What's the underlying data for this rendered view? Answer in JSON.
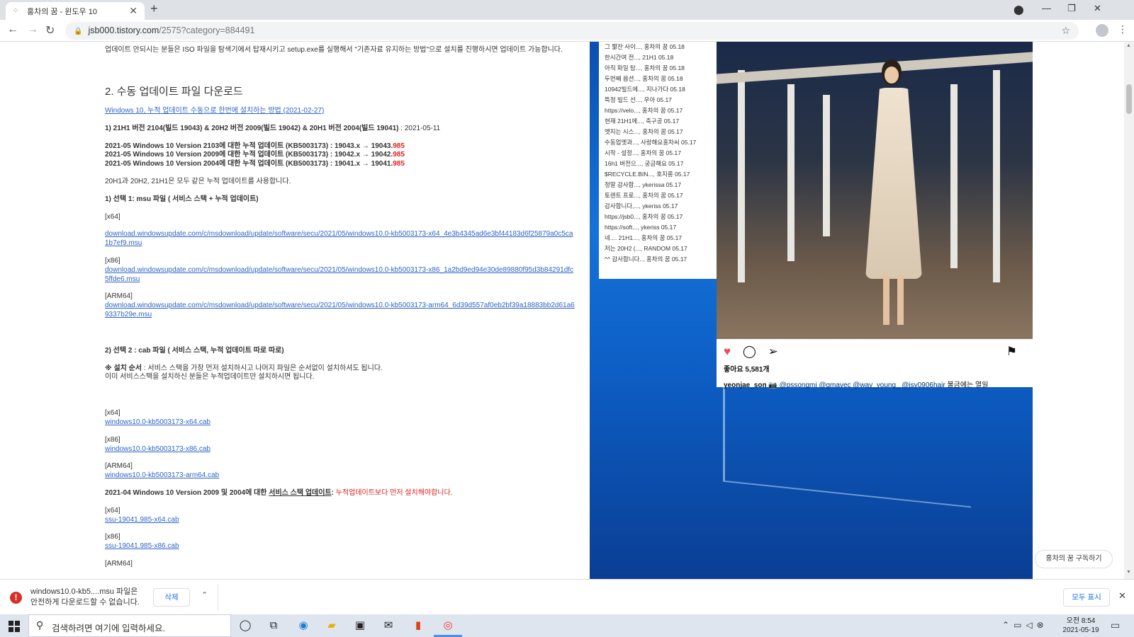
{
  "browser": {
    "tab_title": "홍차의 꿈 - 윈도우 10",
    "url_host": "jsb000.tistory.com",
    "url_path": "/2575?category=884491"
  },
  "article": {
    "intro": "업데이트 안되시는 분들은 ISO 파일을 탐색기에서 탑재시키고 setup.exe를 실행해서 \"기존자료 유지하는 방법\"으로 설치를 진행하시면 업데이트 가능합니다.",
    "heading": "2. 수동 업데이트 파일 다운로드",
    "guide_link": "Windows 10, 누적 업데이트 수동으로 한번에 설치하는 방법 (2021-02-27)",
    "versions_line": "1) 21H1 버전 2104(빌드 19043) & 20H2 버전 2009(빌드 19042) & 20H1 버전 2004(빌드 19041)",
    "versions_date": " : 2021-05-11",
    "kb_lines": [
      {
        "text": "2021-05 Windows 10 Version 2103에 대한 누적 업데이트 (KB5003173) : 19043.x → 19043.",
        "red": "985"
      },
      {
        "text": "2021-05 Windows 10 Version 2009에 대한 누적 업데이트 (KB5003173) : 19042.x → 19042.",
        "red": "985"
      },
      {
        "text": "2021-05 Windows 10 Version 2004에 대한 누적 업데이트 (KB5003173) : 19041.x → 19041.",
        "red": "985"
      }
    ],
    "same_update": "20H1과 20H2, 21H1은 모두 같은 누적 업데이트를 사용합니다.",
    "option1": "1) 선택 1: msu 파일 ( 서비스 스택 + 누적 업데이트)",
    "x64_label": "[x64]",
    "x86_label": "[x86]",
    "arm64_label": "[ARM64]",
    "msu_x64": "download.windowsupdate.com/c/msdownload/update/software/secu/2021/05/windows10.0-kb5003173-x64_4e3b4345ad6e3bf44183d6f25879a0c5ca1b7ef9.msu",
    "msu_x86": "download.windowsupdate.com/c/msdownload/update/software/secu/2021/05/windows10.0-kb5003173-x86_1a2bd9ed94e30de89880f95d3b84291dfc5ffde6.msu",
    "msu_arm64": "download.windowsupdate.com/c/msdownload/update/software/secu/2021/05/windows10.0-kb5003173-arm64_6d39d557af0eb2bf39a18883bb2d61a69337b29e.msu",
    "option2": "2) 선택 2 : cab 파일 ( 서비스 스택, 누적 업데이트 따로 따로)",
    "install_order_label": "※ 설치 순서",
    "install_order_text": " : 서비스 스택을 가장 먼저 설치하시고 나머지 파일은 순서없이 설치하셔도 됩니다.",
    "install_note": "이미 서비스스택을 설치하신 분들은 누적업데이트만 설치하시면 됩니다.",
    "cab_x64": "windows10.0-kb5003173-x64.cab",
    "cab_x86": "windows10.0-kb5003173-x86.cab",
    "cab_arm64": "windows10.0-kb5003173-arm64.cab",
    "ssu_line_pre": "2021-04 Windows 10 Version 2009 및 2004에 대한 ",
    "ssu_line_link": "서비스 스택 업데이트",
    "ssu_line_colon": ": ",
    "ssu_line_red": "누적업데이트보다 먼저 설치해야합니다.",
    "ssu_x64": "ssu-19041.985-x64.cab",
    "ssu_x86": "ssu-19041.985-x86.cab",
    "truncated_label": "[ARM64]"
  },
  "comments": [
    "그 짧잔 사이..., 홍차의 꿈 05.18",
    "한시간여 전..., 21H1 05.18",
    "아직 파일 탐..., 홍차의 꿈 05.18",
    "두번째 옵션..., 홍차의 꿈 05.18",
    "10942빌드에..., 지나가다 05.18",
    "특정 빌드 선..., 우아 05.17",
    "https://velo..., 홍차의 꿈 05.17",
    "현재 21H1에..., 축구공 05.17",
    "엣지는 시스..., 홍차의 꿈 05.17",
    "수동업엣과..., 사랑해요홍차씨 05.17",
    "시작 - 설정..., 홍차의 꿈 05.17",
    "16h1 버전으..., 궁금해요 05.17",
    "$RECYCLE.BIN..., 호지롱 05.17",
    "정말 감사합..., ykerissa 05.17",
    "토렌트 프로..., 홍차의 꿈 05.17",
    "감사합니다,..., ykeriss 05.17",
    "https://jsb0..., 홍차의 꿈 05.17",
    "https://soft..., ykeriss 05.17",
    "네.... 21H1..., 홍차의 꿈 05.17",
    "저는 20H2 (..., RANDOM 05.17",
    "^^ 감사합니다.., 홍차의 꿈 05.17"
  ],
  "instagram": {
    "likes": "좋아요 5,581개",
    "username": "yeonjae_son",
    "caption_tags": "@pssongmi @gmavec @way_young_ @jsy0906hair",
    "caption_text": " 불금에는 열일"
  },
  "subscribe": "홍차의 꿈 구독하기",
  "download": {
    "line1": "windows10.0-kb5....msu 파일은",
    "line2": "안전하게 다운로드할 수 없습니다.",
    "delete_label": "삭제",
    "show_all_label": "모두 표시"
  },
  "taskbar": {
    "search_placeholder": "검색하려면 여기에 입력하세요.",
    "time": "오전 8:54",
    "date": "2021-05-19"
  },
  "colors": {
    "accent": "#1a73e8",
    "link": "#2d64c8",
    "warning": "#d93025",
    "red_text": "#e02020"
  }
}
